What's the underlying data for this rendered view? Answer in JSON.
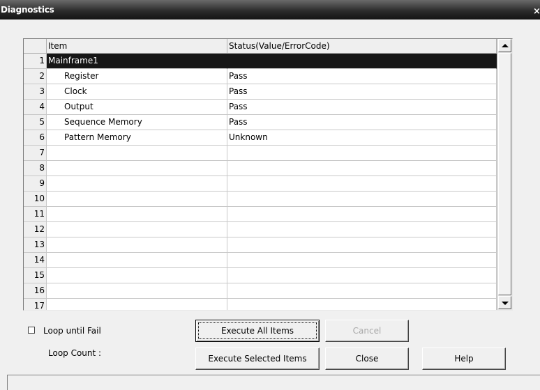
{
  "window": {
    "title": "Diagnostics",
    "close_glyph": "×"
  },
  "grid": {
    "columns": [
      "Item",
      "Status(Value/ErrorCode)"
    ],
    "rows": [
      {
        "num": "1",
        "item": "Mainframe1",
        "status": ""
      },
      {
        "num": "2",
        "item": "Register",
        "status": "Pass"
      },
      {
        "num": "3",
        "item": "Clock",
        "status": "Pass"
      },
      {
        "num": "4",
        "item": "Output",
        "status": "Pass"
      },
      {
        "num": "5",
        "item": "Sequence Memory",
        "status": "Pass"
      },
      {
        "num": "6",
        "item": "Pattern Memory",
        "status": "Unknown"
      },
      {
        "num": "7",
        "item": "",
        "status": ""
      },
      {
        "num": "8",
        "item": "",
        "status": ""
      },
      {
        "num": "9",
        "item": "",
        "status": ""
      },
      {
        "num": "10",
        "item": "",
        "status": ""
      },
      {
        "num": "11",
        "item": "",
        "status": ""
      },
      {
        "num": "12",
        "item": "",
        "status": ""
      },
      {
        "num": "13",
        "item": "",
        "status": ""
      },
      {
        "num": "14",
        "item": "",
        "status": ""
      },
      {
        "num": "15",
        "item": "",
        "status": ""
      },
      {
        "num": "16",
        "item": "",
        "status": ""
      },
      {
        "num": "17",
        "item": "",
        "status": ""
      }
    ],
    "selected_row": "1"
  },
  "options": {
    "loop_until_fail_label": "Loop until Fail",
    "loop_until_fail_checked": false,
    "loop_count_label": "Loop Count :"
  },
  "buttons": {
    "execute_all": "Execute All Items",
    "cancel": "Cancel",
    "execute_selected": "Execute Selected Items",
    "close": "Close",
    "help": "Help"
  },
  "colors": {
    "selection": "#161616",
    "title_bar": "#2c2c2c"
  }
}
